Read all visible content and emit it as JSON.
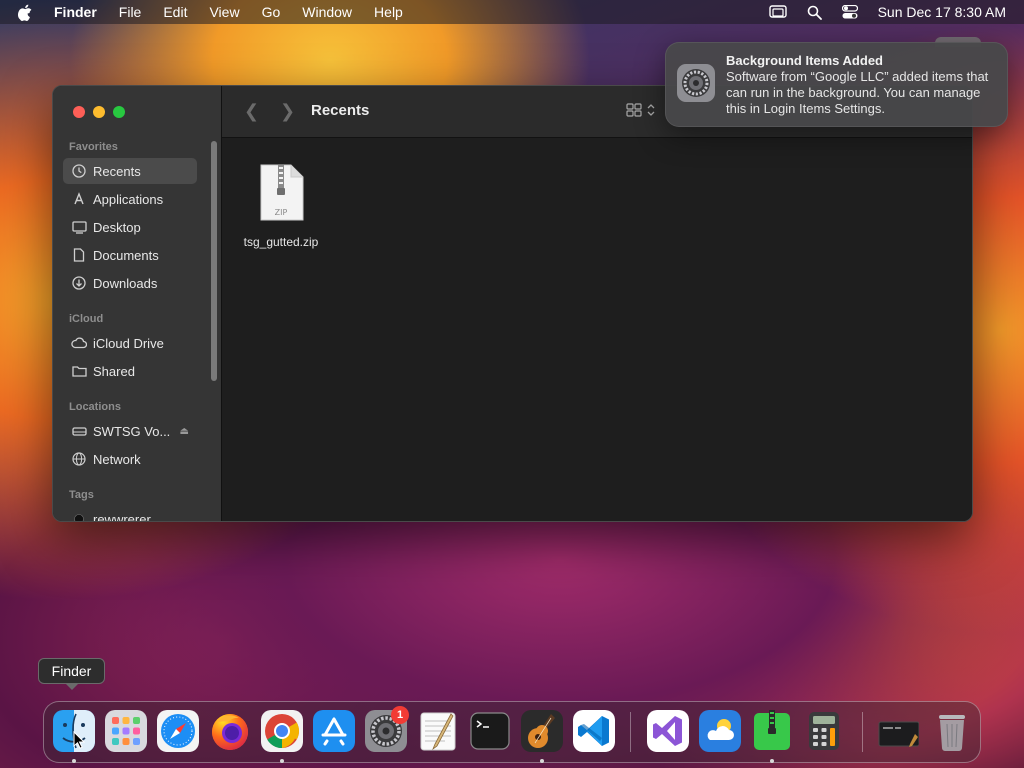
{
  "menubar": {
    "app": "Finder",
    "menus": [
      "File",
      "Edit",
      "View",
      "Go",
      "Window",
      "Help"
    ],
    "clock": "Sun Dec 17  8:30 AM",
    "status_icons": [
      "screen-mirroring-icon",
      "spotlight-search-icon",
      "control-center-icon"
    ]
  },
  "finder": {
    "title": "Recents",
    "sidebar": {
      "favorites_label": "Favorites",
      "favorites": [
        {
          "label": "Recents",
          "icon": "clock-icon"
        },
        {
          "label": "Applications",
          "icon": "applications-icon"
        },
        {
          "label": "Desktop",
          "icon": "desktop-icon"
        },
        {
          "label": "Documents",
          "icon": "document-icon"
        },
        {
          "label": "Downloads",
          "icon": "download-icon"
        }
      ],
      "icloud_label": "iCloud",
      "icloud": [
        {
          "label": "iCloud Drive",
          "icon": "cloud-icon"
        },
        {
          "label": "Shared",
          "icon": "shared-folder-icon"
        }
      ],
      "locations_label": "Locations",
      "locations": [
        {
          "label": "SWTSG Vo...",
          "icon": "drive-icon"
        },
        {
          "label": "Network",
          "icon": "globe-icon"
        }
      ],
      "tags_label": "Tags",
      "tags": [
        {
          "label": "rewwrerer",
          "color": "#1a1a1a"
        }
      ]
    },
    "files": [
      {
        "name": "tsg_gutted.zip",
        "kind": "ZIP"
      }
    ]
  },
  "notification": {
    "title": "Background Items Added",
    "body": "Software from “Google LLC” added items that can run in the background. You can manage this in Login Items Settings.",
    "icon": "system-settings-gear-icon"
  },
  "tooltip": "Finder",
  "dock": {
    "apps": [
      "Finder",
      "Launchpad",
      "Safari",
      "Firefox",
      "Google Chrome",
      "App Store",
      "System Settings",
      "TextEdit",
      "Terminal",
      "GarageBand",
      "Visual Studio Code",
      "Visual Studio",
      "Weather",
      "Archive Utility",
      "Calculator",
      "Downloads Stack",
      "Trash"
    ],
    "settings_badge": "1"
  }
}
